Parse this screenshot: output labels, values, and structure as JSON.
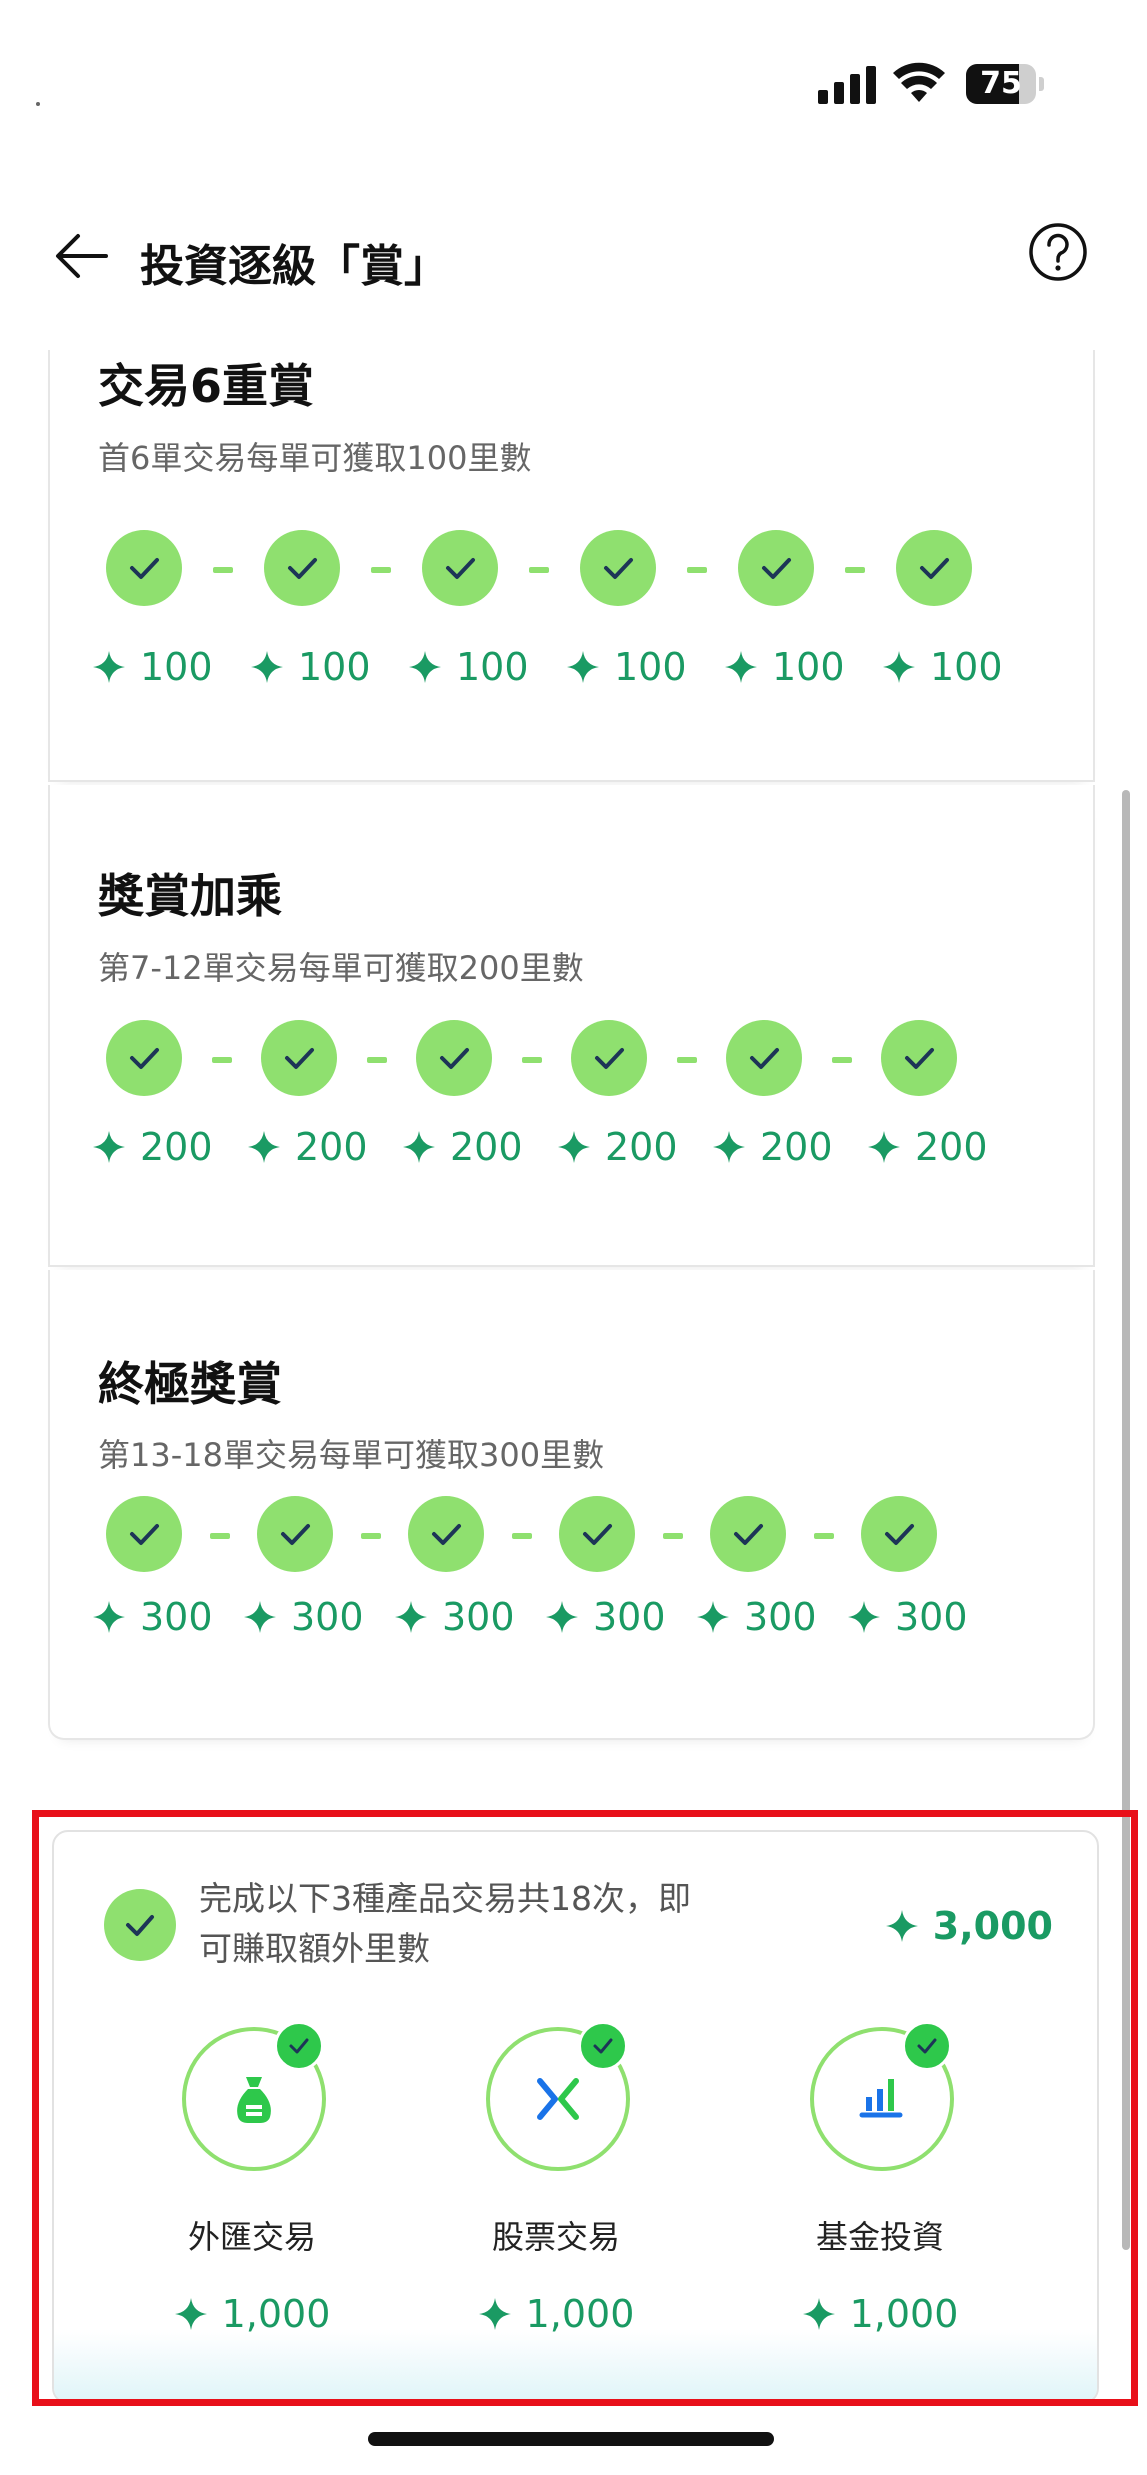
{
  "status": {
    "battery": "75"
  },
  "header": {
    "title": "投資逐級「賞」"
  },
  "tiers": [
    {
      "title": "交易6重賞",
      "subtitle": "首6單交易每單可獲取100里數",
      "rewards": [
        "100",
        "100",
        "100",
        "100",
        "100",
        "100"
      ]
    },
    {
      "title": "獎賞加乘",
      "subtitle": "第7-12單交易每單可獲取200里數",
      "rewards": [
        "200",
        "200",
        "200",
        "200",
        "200",
        "200"
      ]
    },
    {
      "title": "終極獎賞",
      "subtitle": "第13-18單交易每單可獲取300里數",
      "rewards": [
        "300",
        "300",
        "300",
        "300",
        "300",
        "300"
      ]
    }
  ],
  "bonus": {
    "description": "完成以下3種產品交易共18次，即可賺取額外里數",
    "total": "3,000",
    "products": [
      {
        "label": "外匯交易",
        "reward": "1,000",
        "icon": "money-bag-icon"
      },
      {
        "label": "股票交易",
        "reward": "1,000",
        "icon": "stock-exchange-icon"
      },
      {
        "label": "基金投資",
        "reward": "1,000",
        "icon": "fund-chart-icon"
      }
    ]
  },
  "colors": {
    "accent_green": "#8fe06f",
    "reward_text": "#1a9a63",
    "badge_green": "#2ec84b",
    "highlight_red": "#e8101a"
  }
}
